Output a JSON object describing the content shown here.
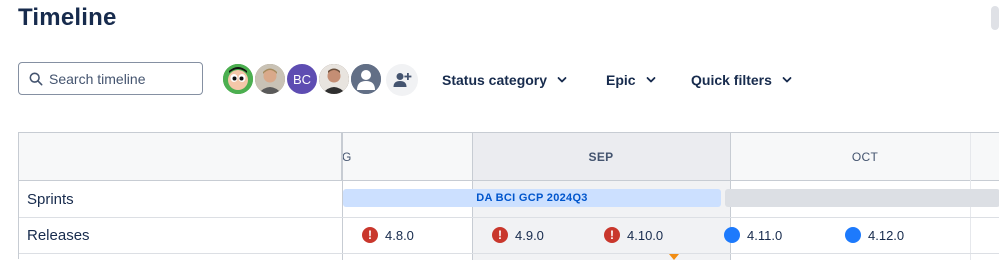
{
  "page": {
    "title": "Timeline"
  },
  "search": {
    "placeholder": "Search timeline"
  },
  "avatars": [
    {
      "kind": "image",
      "icon": "cartoon-avatar-icon",
      "color": "#43a047"
    },
    {
      "kind": "image",
      "icon": "person-photo-icon",
      "color": "#8d8169"
    },
    {
      "kind": "initials",
      "initials": "BC",
      "color": "#5e4db2"
    },
    {
      "kind": "image",
      "icon": "person-photo-icon",
      "color": "#6d5a4c"
    },
    {
      "kind": "default",
      "icon": "default-user-icon",
      "color": "#626f86"
    }
  ],
  "add_people": {
    "icon": "add-person-icon"
  },
  "filters": [
    {
      "label": "Status category",
      "icon": "chevron-down-icon"
    },
    {
      "label": "Epic",
      "icon": "chevron-down-icon"
    },
    {
      "label": "Quick filters",
      "icon": "chevron-down-icon"
    }
  ],
  "timeline": {
    "months": [
      {
        "label": "G"
      },
      {
        "label": "SEP",
        "current": true
      },
      {
        "label": "OCT"
      }
    ],
    "rows": {
      "sprints": {
        "label": "Sprints",
        "items": [
          {
            "label": "DA BCI GCP 2024Q3",
            "state": "active"
          },
          {
            "label": "",
            "state": "future"
          }
        ]
      },
      "releases": {
        "label": "Releases",
        "items": [
          {
            "label": "4.8.0",
            "status": "warning",
            "icon": "exclamation-icon"
          },
          {
            "label": "4.9.0",
            "status": "warning",
            "icon": "exclamation-icon"
          },
          {
            "label": "4.10.0",
            "status": "warning",
            "icon": "exclamation-icon"
          },
          {
            "label": "4.11.0",
            "status": "unreleased",
            "icon": "release-dot-icon"
          },
          {
            "label": "4.12.0",
            "status": "unreleased",
            "icon": "release-dot-icon"
          }
        ]
      }
    }
  },
  "colors": {
    "title": "#172b4d",
    "sprint_active": "#cce0ff",
    "sprint_active_text": "#0055cc",
    "release_warning": "#c9372c",
    "release_unreleased": "#1d7afc",
    "today_marker": "#f18d13"
  }
}
